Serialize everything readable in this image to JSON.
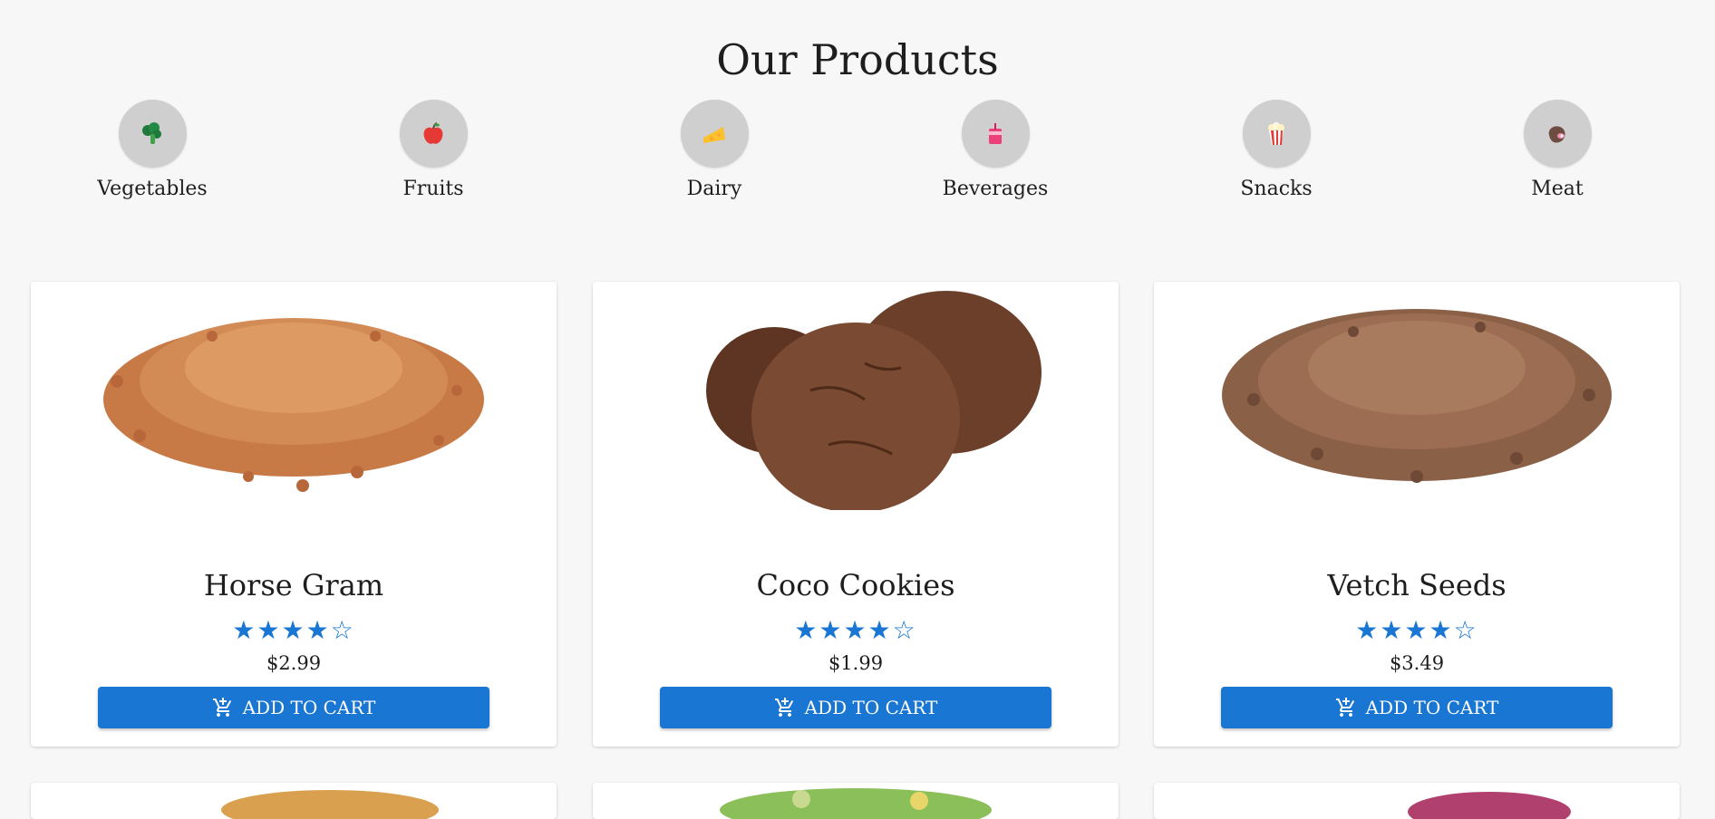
{
  "page_title": "Our Products",
  "categories": [
    {
      "label": "Vegetables",
      "icon": "broccoli-icon"
    },
    {
      "label": "Fruits",
      "icon": "apple-icon"
    },
    {
      "label": "Dairy",
      "icon": "cheese-icon"
    },
    {
      "label": "Beverages",
      "icon": "drink-icon"
    },
    {
      "label": "Snacks",
      "icon": "popcorn-icon"
    },
    {
      "label": "Meat",
      "icon": "meat-icon"
    }
  ],
  "products": [
    {
      "name": "Horse Gram",
      "rating": 4,
      "rating_max": 5,
      "price": "$2.99",
      "button_label": "ADD TO CART",
      "image": "horse-gram-image"
    },
    {
      "name": "Coco Cookies",
      "rating": 4,
      "rating_max": 5,
      "price": "$1.99",
      "button_label": "ADD TO CART",
      "image": "coco-cookies-image"
    },
    {
      "name": "Vetch Seeds",
      "rating": 4,
      "rating_max": 5,
      "price": "$3.49",
      "button_label": "ADD TO CART",
      "image": "vetch-seeds-image"
    }
  ],
  "colors": {
    "accent": "#1976d2",
    "background": "#f7f7f7",
    "category_circle": "#cfcfcf"
  }
}
